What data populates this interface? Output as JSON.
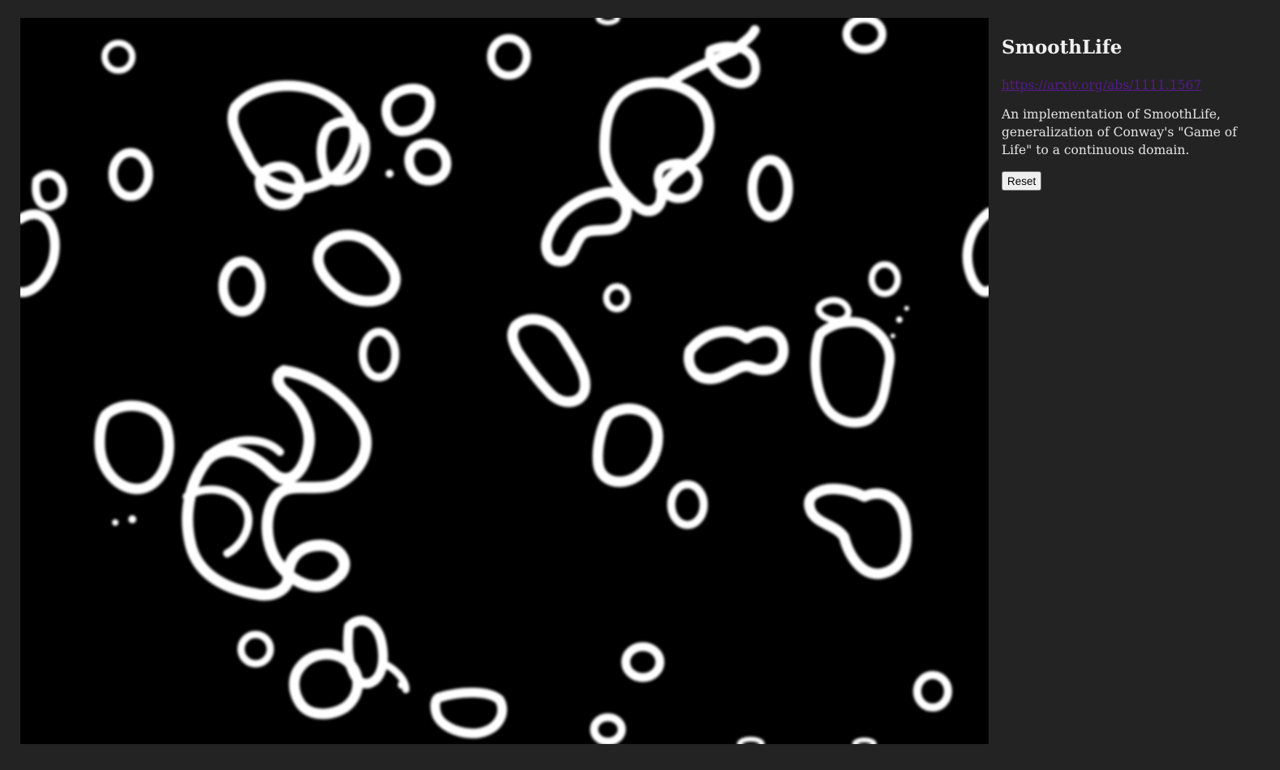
{
  "simulation": {
    "name": "smoothlife-grid",
    "background_color": "#000000",
    "cell_color": "#ffffff"
  },
  "sidebar": {
    "title": "SmoothLife",
    "link_text": "https://arxiv.org/abs/1111.1567",
    "link_href": "https://arxiv.org/abs/1111.1567",
    "description": "An implementation of SmoothLife, generalization of Conway's \"Game of Life\" to a continuous domain.",
    "reset_label": "Reset"
  },
  "colors": {
    "page_background": "#232323",
    "text": "#e6e6e6",
    "visited_link": "#551a8b"
  }
}
